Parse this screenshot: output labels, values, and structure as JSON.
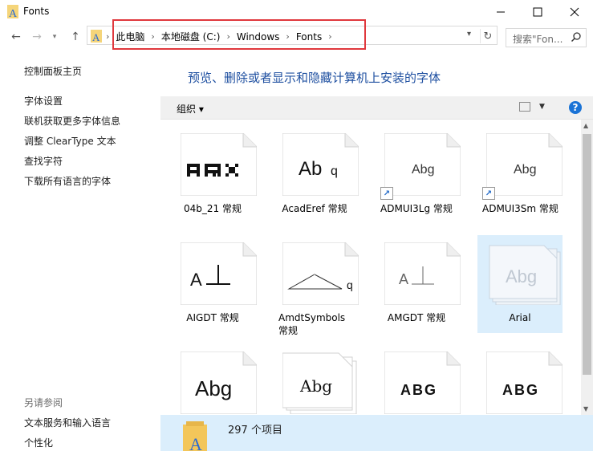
{
  "window": {
    "title": "Fonts"
  },
  "address": {
    "crumbs": [
      "此电脑",
      "本地磁盘 (C:)",
      "Windows",
      "Fonts"
    ],
    "search_placeholder": "搜索\"Fon..."
  },
  "sidebar": {
    "top_links": [
      "控制面板主页",
      "字体设置",
      "联机获取更多字体信息",
      "调整 ClearType 文本",
      "查找字符",
      "下载所有语言的字体"
    ],
    "see_also_title": "另请参阅",
    "bottom_links": [
      "文本服务和输入语言",
      "个性化"
    ]
  },
  "main": {
    "headline": "预览、删除或者显示和隐藏计算机上安装的字体",
    "organize_label": "组织 ▾"
  },
  "fonts": [
    {
      "name": "04b_21 常规",
      "sample": "AЯX"
    },
    {
      "name": "AcadEref 常规",
      "sample": "Abq"
    },
    {
      "name": "ADMUI3Lg 常规",
      "sample": "Abg",
      "shortcut": true
    },
    {
      "name": "ADMUI3Sm 常规",
      "sample": "Abg",
      "shortcut": true
    },
    {
      "name": "AIGDT 常规",
      "sample": "A⊥"
    },
    {
      "name": "AmdtSymbols 常规",
      "sample": "q"
    },
    {
      "name": "AMGDT 常规",
      "sample": "A⊥"
    },
    {
      "name": "Arial",
      "sample": "Abg",
      "selected": true
    },
    {
      "name": "",
      "sample": "Abg"
    },
    {
      "name": "",
      "sample": "Abg"
    },
    {
      "name": "",
      "sample": "ABG"
    },
    {
      "name": "",
      "sample": "ABG"
    }
  ],
  "status": {
    "count_text": "297 个项目"
  },
  "colors": {
    "accent": "#1e4fa0",
    "highlight": "#e0383d",
    "selection": "#dbeefc"
  }
}
